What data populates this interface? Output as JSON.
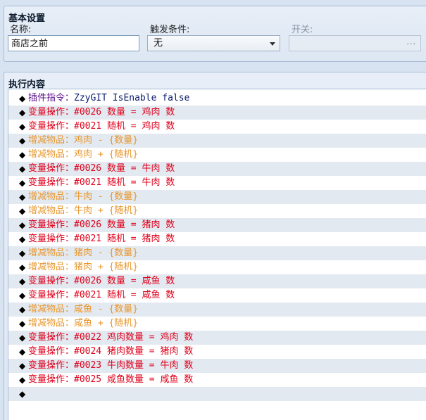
{
  "basic": {
    "title": "基本设置",
    "name_label": "名称:",
    "name_value": "商店之前",
    "trigger_label": "触发条件:",
    "trigger_value": "无",
    "switch_label": "开关:",
    "switch_button": "..."
  },
  "exec": {
    "title": "执行内容",
    "bullet": "◆",
    "rows": [
      {
        "text": "插件指令：ZzyGIT IsEnable false",
        "color": "#3a1f8a",
        "prefix_color": "#4b0f8a"
      },
      {
        "text": "变量操作：#0026 数量 = 鸡肉 数",
        "color": "#e0001b"
      },
      {
        "text": "变量操作：#0021 随机 = 鸡肉 数",
        "color": "#e0001b"
      },
      {
        "text": "增减物品：鸡肉 - {数量}",
        "color": "#e8962c"
      },
      {
        "text": "增减物品：鸡肉 + {随机}",
        "color": "#e8962c"
      },
      {
        "text": "变量操作：#0026 数量 = 牛肉 数",
        "color": "#e0001b"
      },
      {
        "text": "变量操作：#0021 随机 = 牛肉 数",
        "color": "#e0001b"
      },
      {
        "text": "增减物品：牛肉 - {数量}",
        "color": "#e8962c"
      },
      {
        "text": "增减物品：牛肉 + {随机}",
        "color": "#e8962c"
      },
      {
        "text": "变量操作：#0026 数量 = 猪肉 数",
        "color": "#e0001b"
      },
      {
        "text": "变量操作：#0021 随机 = 猪肉 数",
        "color": "#e0001b"
      },
      {
        "text": "增减物品：猪肉 - {数量}",
        "color": "#e8962c"
      },
      {
        "text": "增减物品：猪肉 + {随机}",
        "color": "#e8962c"
      },
      {
        "text": "变量操作：#0026 数量 = 咸鱼 数",
        "color": "#e0001b"
      },
      {
        "text": "变量操作：#0021 随机 = 咸鱼 数",
        "color": "#e0001b"
      },
      {
        "text": "增减物品：咸鱼 - {数量}",
        "color": "#e8962c"
      },
      {
        "text": "增减物品：咸鱼 + {随机}",
        "color": "#e8962c"
      },
      {
        "text": "变量操作：#0022 鸡肉数量 = 鸡肉 数",
        "color": "#e0001b"
      },
      {
        "text": "变量操作：#0024 猪肉数量 = 猪肉 数",
        "color": "#e0001b"
      },
      {
        "text": "变量操作：#0023 牛肉数量 = 牛肉 数",
        "color": "#e0001b"
      },
      {
        "text": "变量操作：#0025 咸鱼数量 = 咸鱼 数",
        "color": "#e0001b"
      },
      {
        "text": "",
        "color": "#000000"
      }
    ]
  }
}
